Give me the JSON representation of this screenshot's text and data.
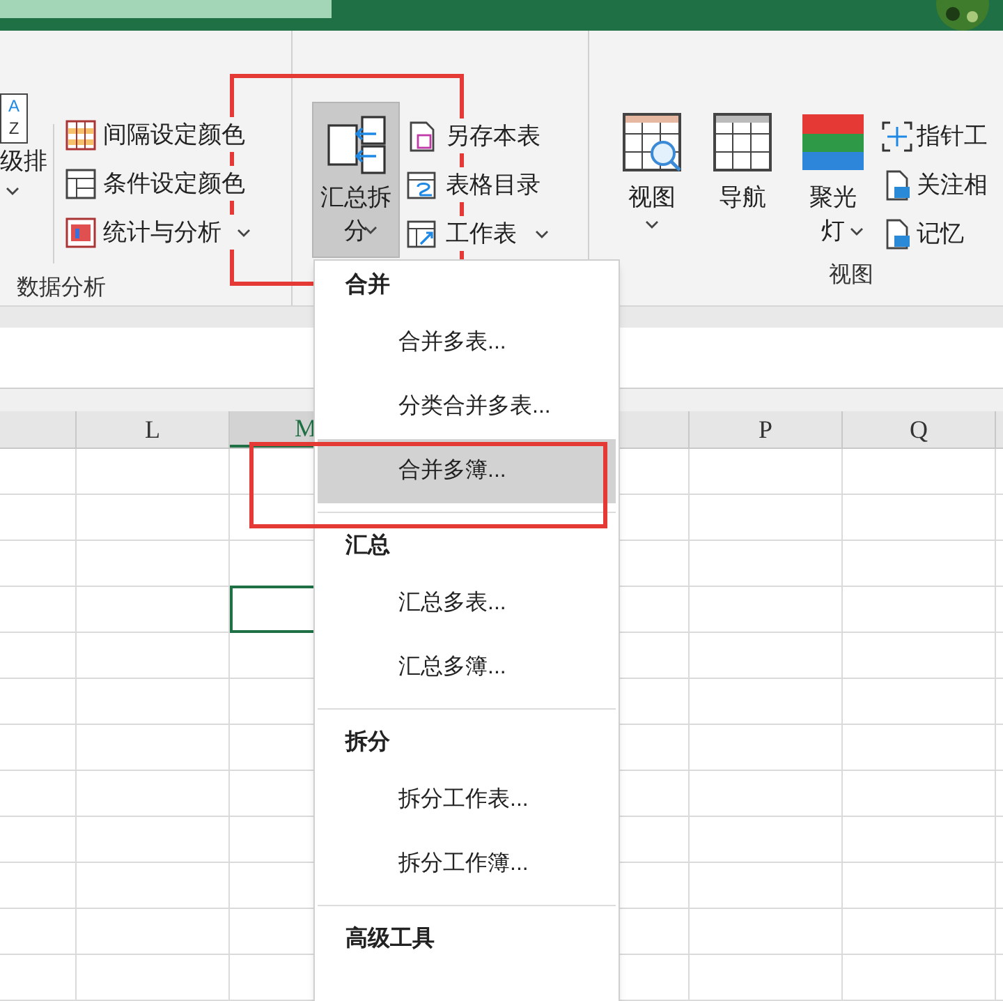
{
  "ribbon": {
    "sort_button": {
      "icon_letters": [
        "A",
        "Z"
      ],
      "label": "级排",
      "dropdown": true
    },
    "analysis_items": [
      {
        "label": "间隔设定颜色",
        "dropdown": false
      },
      {
        "label": "条件设定颜色",
        "dropdown": false
      },
      {
        "label": "统计与分析",
        "dropdown": true
      }
    ],
    "analysis_group_label": "数据分析",
    "merge_split_button": {
      "label": "汇总拆分",
      "dropdown": true,
      "pressed": true
    },
    "sheet_items": [
      {
        "label": "另存本表",
        "dropdown": false
      },
      {
        "label": "表格目录",
        "dropdown": false
      },
      {
        "label": "工作表",
        "dropdown": true
      }
    ],
    "view_buttons": [
      {
        "label": "视图",
        "dropdown": true
      },
      {
        "label": "导航",
        "dropdown": false
      },
      {
        "label": "聚光灯",
        "dropdown": true
      }
    ],
    "view_items": [
      {
        "label": "指针工"
      },
      {
        "label": "关注相"
      },
      {
        "label": "记忆"
      }
    ],
    "view_group_label": "视图"
  },
  "sheet": {
    "columns": [
      {
        "label": "L",
        "selected": false
      },
      {
        "label": "M",
        "selected": true
      },
      {
        "label": "P",
        "selected": false
      },
      {
        "label": "Q",
        "selected": false
      }
    ],
    "rows": [
      {
        "selected": false
      },
      {
        "selected": false
      },
      {
        "selected": false
      },
      {
        "selected": true
      },
      {
        "selected": false
      },
      {
        "selected": false
      },
      {
        "selected": false
      },
      {
        "selected": false
      },
      {
        "selected": false
      },
      {
        "selected": false
      },
      {
        "selected": false
      },
      {
        "selected": false
      }
    ]
  },
  "dropdown_menu": {
    "sections": [
      {
        "header": "合并",
        "items": [
          {
            "label": "合并多表...",
            "selected": false
          },
          {
            "label": "分类合并多表...",
            "selected": false
          },
          {
            "label": "合并多簿...",
            "selected": true
          }
        ]
      },
      {
        "header": "汇总",
        "items": [
          {
            "label": "汇总多表...",
            "selected": false
          },
          {
            "label": "汇总多簿...",
            "selected": false
          }
        ]
      },
      {
        "header": "拆分",
        "items": [
          {
            "label": "拆分工作表...",
            "selected": false
          },
          {
            "label": "拆分工作簿...",
            "selected": false
          }
        ]
      },
      {
        "header": "高级工具"
      }
    ]
  }
}
